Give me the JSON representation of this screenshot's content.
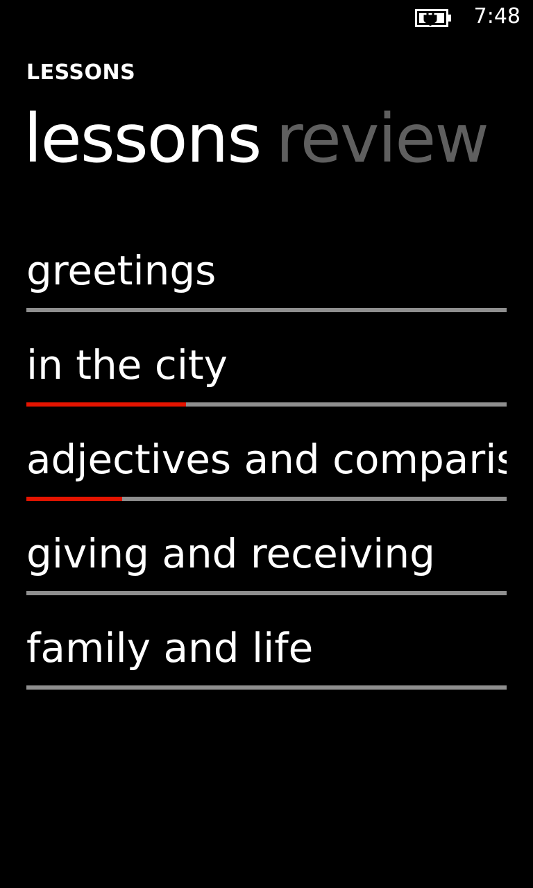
{
  "status_bar": {
    "time": "7:48",
    "battery_icon": "battery-charging-icon"
  },
  "app_title": "LESSONS",
  "pivot": {
    "items": [
      {
        "label": "lessons",
        "active": true
      },
      {
        "label": "review",
        "active": false
      }
    ]
  },
  "colors": {
    "accent": "#e51400",
    "track": "#8f8f8f",
    "background": "#000000",
    "inactive_text": "#5f5f5f"
  },
  "lessons": [
    {
      "label": "greetings",
      "progress": 0
    },
    {
      "label": "in the city",
      "progress": 0.333
    },
    {
      "label": "adjectives and comparisons",
      "progress": 0.2
    },
    {
      "label": "giving and receiving",
      "progress": 0
    },
    {
      "label": "family and life",
      "progress": 0
    }
  ]
}
